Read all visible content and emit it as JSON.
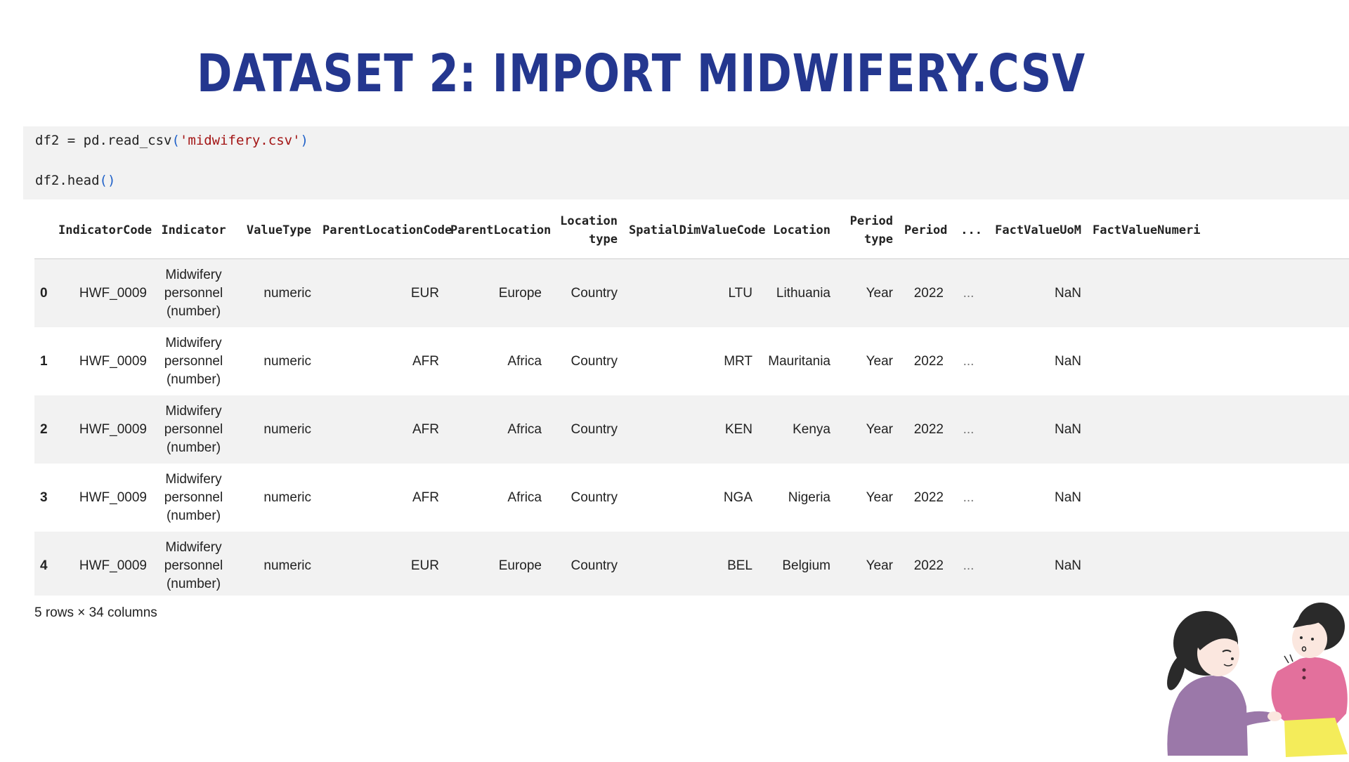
{
  "slide": {
    "title": "DATASET 2: IMPORT MIDWIFERY.CSV"
  },
  "code_cell": {
    "line1": {
      "pre": "df2 = pd.read_csv",
      "open": "(",
      "str": "'midwifery.csv'",
      "close": ")"
    },
    "line2": {
      "pre": "df2.head",
      "parens": "()"
    }
  },
  "dataframe": {
    "columns": [
      "",
      "IndicatorCode",
      "Indicator",
      "ValueType",
      "ParentLocationCode",
      "ParentLocation",
      "Location type",
      "SpatialDimValueCode",
      "Location",
      "Period type",
      "Period",
      "...",
      "FactValueUoM",
      "FactValueNumeri"
    ],
    "rows": [
      [
        "0",
        "HWF_0009",
        "Midwifery personnel (number)",
        "numeric",
        "EUR",
        "Europe",
        "Country",
        "LTU",
        "Lithuania",
        "Year",
        "2022",
        "...",
        "NaN",
        ""
      ],
      [
        "1",
        "HWF_0009",
        "Midwifery personnel (number)",
        "numeric",
        "AFR",
        "Africa",
        "Country",
        "MRT",
        "Mauritania",
        "Year",
        "2022",
        "...",
        "NaN",
        ""
      ],
      [
        "2",
        "HWF_0009",
        "Midwifery personnel (number)",
        "numeric",
        "AFR",
        "Africa",
        "Country",
        "KEN",
        "Kenya",
        "Year",
        "2022",
        "...",
        "NaN",
        ""
      ],
      [
        "3",
        "HWF_0009",
        "Midwifery personnel (number)",
        "numeric",
        "AFR",
        "Africa",
        "Country",
        "NGA",
        "Nigeria",
        "Year",
        "2022",
        "...",
        "NaN",
        ""
      ],
      [
        "4",
        "HWF_0009",
        "Midwifery personnel (number)",
        "numeric",
        "EUR",
        "Europe",
        "Country",
        "BEL",
        "Belgium",
        "Year",
        "2022",
        "...",
        "NaN",
        ""
      ]
    ],
    "shape": "5 rows × 34 columns"
  },
  "colors": {
    "title": "#24378f",
    "code_background": "#f2f2f2",
    "string_literal": "#a31515",
    "parenthesis": "#2162c9",
    "striped_row": "#f2f2f2"
  },
  "illustration": {
    "icon": "midwife-with-pregnant-woman-illustration"
  }
}
